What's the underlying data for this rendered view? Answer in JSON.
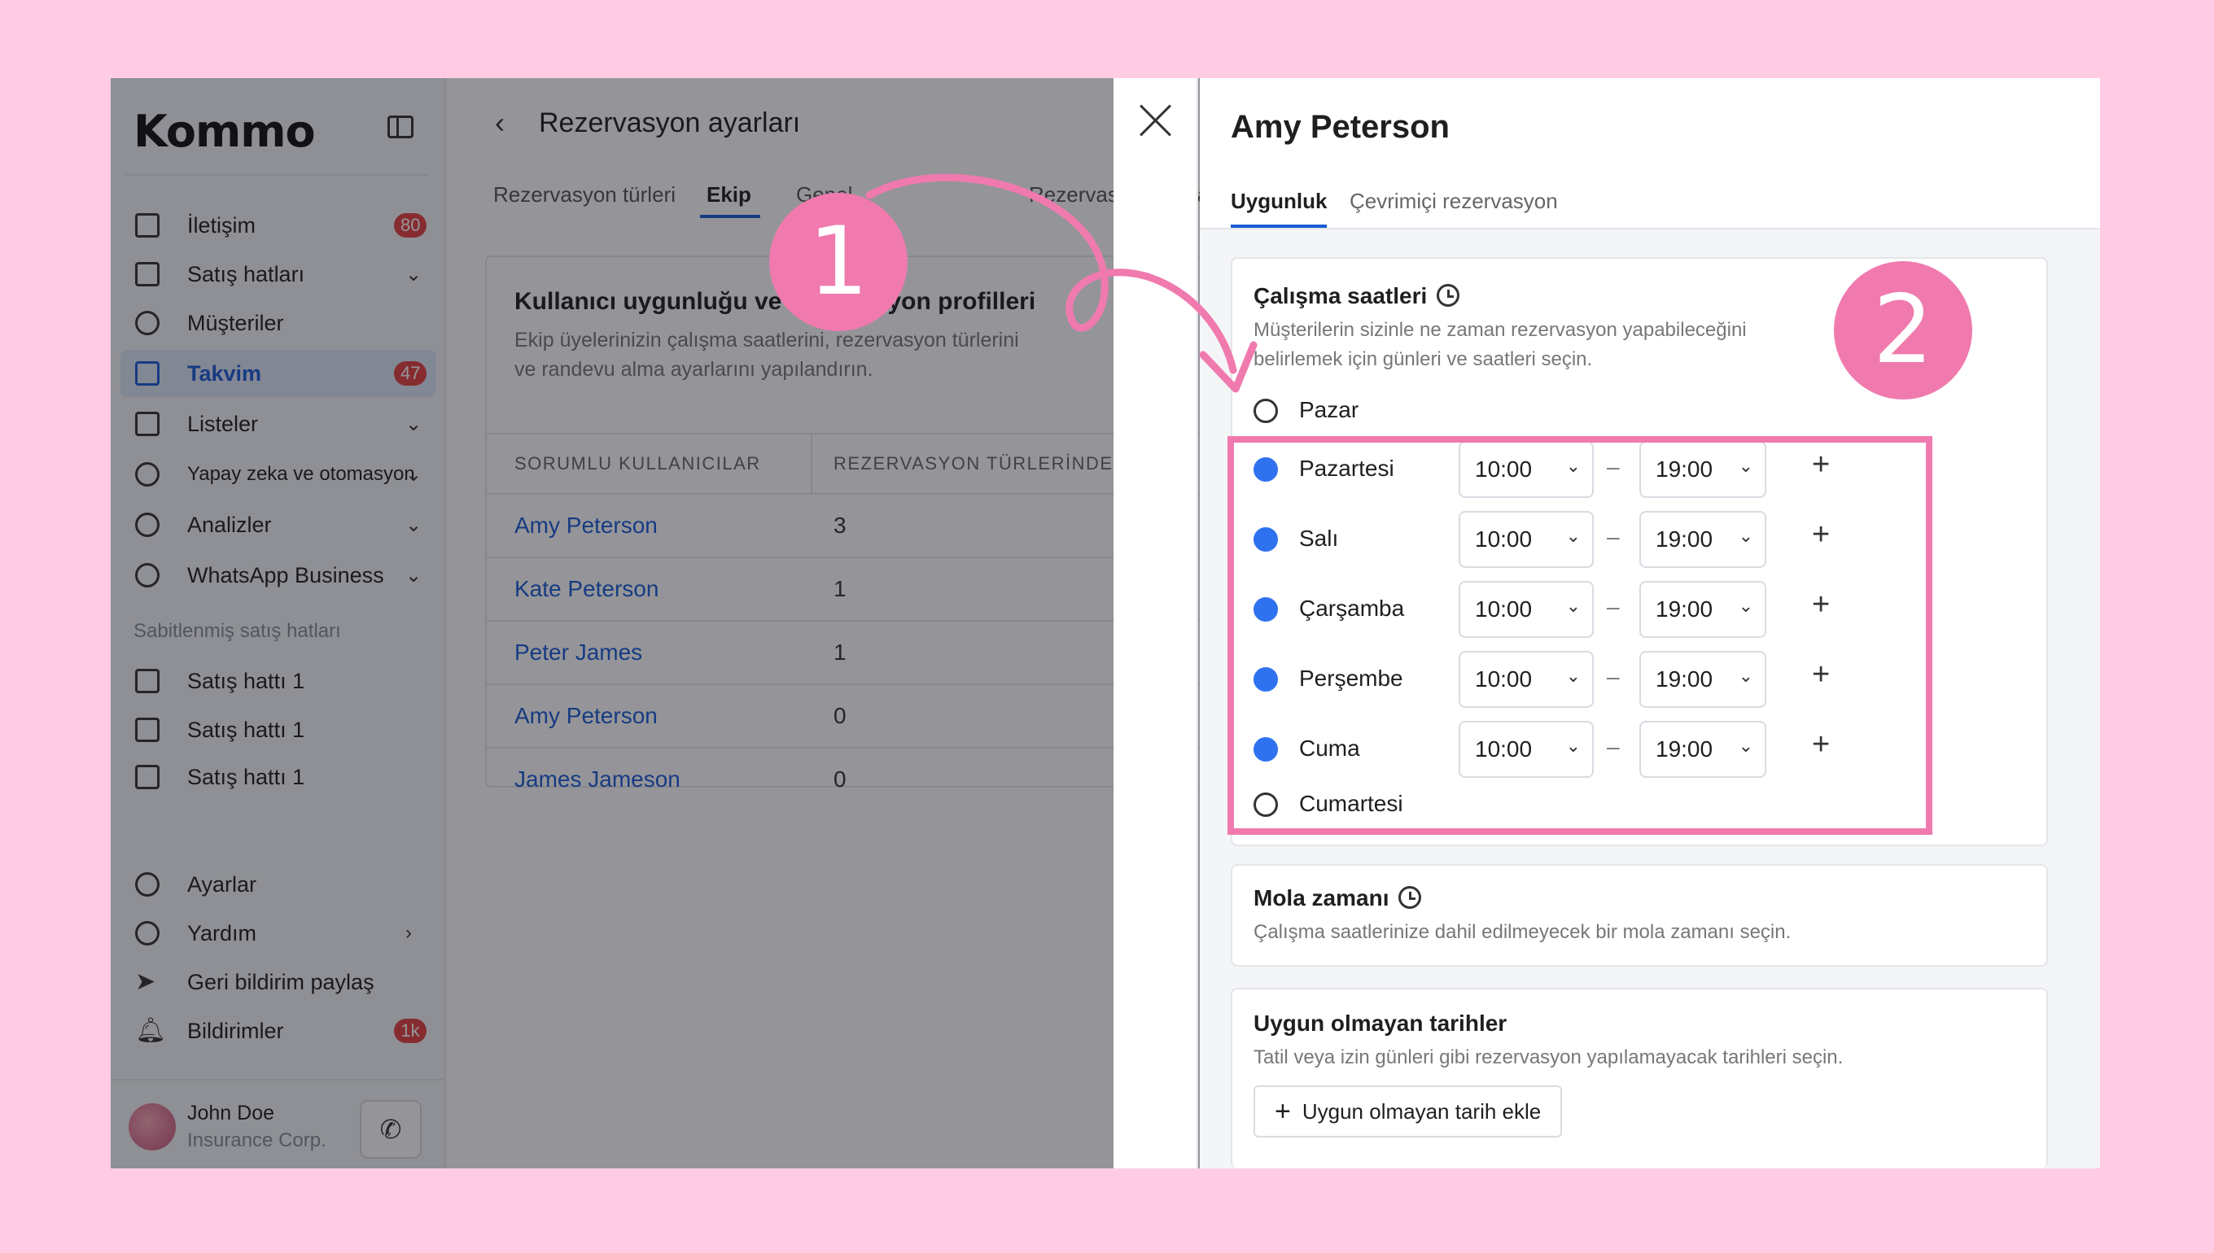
{
  "sidebar": {
    "logo": "Kommo",
    "items": [
      {
        "label": "İletişim",
        "icon": "chat-icon",
        "badge": "80"
      },
      {
        "label": "Satış hatları",
        "icon": "pipeline-icon"
      },
      {
        "label": "Müşteriler",
        "icon": "customers-icon"
      },
      {
        "label": "Takvim",
        "icon": "calendar-icon",
        "badge": "47"
      },
      {
        "label": "Listeler",
        "icon": "list-icon"
      },
      {
        "label": "Yapay zeka ve otomasyon",
        "icon": "automation-icon"
      },
      {
        "label": "Analizler",
        "icon": "analytics-icon"
      },
      {
        "label": "WhatsApp Business",
        "icon": "whatsapp-icon"
      }
    ],
    "pinned_title": "Sabitlenmiş satış hatları",
    "pinned": [
      "Satış hattı 1",
      "Satış hattı 1",
      "Satış hattı 1"
    ],
    "bottom": [
      {
        "label": "Ayarlar",
        "icon": "gear-icon"
      },
      {
        "label": "Yardım",
        "icon": "help-icon"
      },
      {
        "label": "Geri bildirim paylaş",
        "icon": "send-icon"
      },
      {
        "label": "Bildirimler",
        "icon": "bell-icon",
        "badge": "1k"
      }
    ],
    "user": {
      "name": "John Doe",
      "company": "Insurance Corp."
    }
  },
  "settings": {
    "title": "Rezervasyon ayarları",
    "tabs": [
      "Rezervasyon türleri",
      "Ekip",
      "Genel",
      "Rezervasyon sayfası"
    ],
    "card": {
      "title": "Kullanıcı uygunluğu ve rezervasyon profilleri",
      "desc": "Ekip üyelerinizin çalışma saatlerini, rezervasyon türlerini ve randevu alma ayarlarını yapılandırın.",
      "columns": [
        "SORUMLU KULLANICILAR",
        "REZERVASYON TÜRLERİNDE"
      ],
      "rows": [
        {
          "name": "Amy Peterson",
          "count": "3"
        },
        {
          "name": "Kate Peterson",
          "count": "1"
        },
        {
          "name": "Peter James",
          "count": "1"
        },
        {
          "name": "Amy Peterson",
          "count": "0"
        },
        {
          "name": "James Jameson",
          "count": "0"
        }
      ]
    }
  },
  "drawer": {
    "title": "Amy Peterson",
    "tabs": [
      "Uygunluk",
      "Çevrimiçi rezervasyon"
    ],
    "working_hours": {
      "title": "Çalışma saatleri",
      "desc": "Müşterilerin sizinle ne zaman rezervasyon yapabileceğini belirlemek için günleri ve saatleri seçin.",
      "days": [
        {
          "label": "Pazar",
          "on": false
        },
        {
          "label": "Pazartesi",
          "on": true,
          "from": "10:00",
          "to": "19:00"
        },
        {
          "label": "Salı",
          "on": true,
          "from": "10:00",
          "to": "19:00"
        },
        {
          "label": "Çarşamba",
          "on": true,
          "from": "10:00",
          "to": "19:00"
        },
        {
          "label": "Perşembe",
          "on": true,
          "from": "10:00",
          "to": "19:00"
        },
        {
          "label": "Cuma",
          "on": true,
          "from": "10:00",
          "to": "19:00"
        },
        {
          "label": "Cumartesi",
          "on": false
        }
      ]
    },
    "break_time": {
      "title": "Mola zamanı",
      "desc": "Çalışma saatlerinize dahil edilmeyecek bir mola zamanı seçin."
    },
    "unavailable": {
      "title": "Uygun olmayan tarihler",
      "desc": "Tatil veya izin günleri gibi rezervasyon yapılamayacak tarihleri seçin.",
      "button": "Uygun olmayan tarih ekle"
    }
  },
  "annotations": {
    "step1": "1",
    "step2": "2",
    "color": "#f07aae"
  },
  "colors": {
    "accent": "#1a5bd6",
    "radio_on": "#2f72f0",
    "badge": "#e34141"
  }
}
